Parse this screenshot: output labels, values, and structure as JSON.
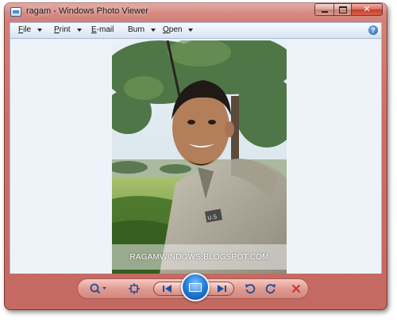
{
  "window": {
    "title": "ragam - Windows Photo Viewer",
    "caption_buttons": {
      "close_glyph": "✕"
    }
  },
  "menu": {
    "items": [
      {
        "label_underlined": "F",
        "label_rest": "ile"
      },
      {
        "label_underlined": "P",
        "label_rest": "rint"
      },
      {
        "label_underlined": "E",
        "label_rest": "-mail"
      },
      {
        "label_underlined": "",
        "label_rest": "Burn"
      },
      {
        "label_underlined": "O",
        "label_rest": "pen"
      }
    ],
    "help_glyph": "?"
  },
  "photo": {
    "watermark": "RAGAMWINDOWS.BLOGSPOT.COM",
    "badge_text": "U.S"
  },
  "toolbar": {
    "icons": [
      "zoom-icon",
      "actual-size-icon",
      "previous-icon",
      "slideshow-icon",
      "next-icon",
      "rotate-counterclockwise-icon",
      "rotate-clockwise-icon",
      "delete-icon"
    ]
  },
  "colors": {
    "frame": "#c96e66",
    "menubar": "#e6eef8",
    "accent": "#2a7fd6",
    "delete": "#d0352a"
  }
}
